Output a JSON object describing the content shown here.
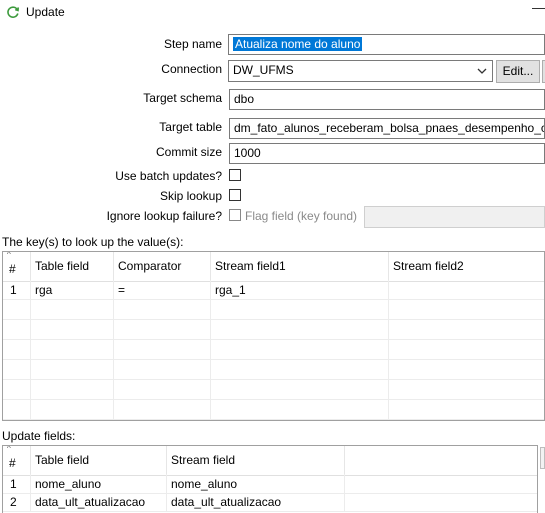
{
  "window": {
    "title": "Update"
  },
  "form": {
    "step_name_label": "Step name",
    "step_name_value": "Atualiza nome do aluno",
    "connection_label": "Connection",
    "connection_value": "DW_UFMS",
    "edit_button": "Edit...",
    "target_schema_label": "Target schema",
    "target_schema_value": "dbo",
    "target_table_label": "Target table",
    "target_table_value": "dm_fato_alunos_receberam_bolsa_pnaes_desempenho_ch",
    "commit_size_label": "Commit size",
    "commit_size_value": "1000",
    "batch_updates_label": "Use batch updates?",
    "skip_lookup_label": "Skip lookup",
    "ignore_failure_label": "Ignore lookup failure?",
    "flag_field_label": "Flag field (key found)"
  },
  "keys_section": {
    "title": "The key(s) to look up the value(s):",
    "columns": [
      "#",
      "Table field",
      "Comparator",
      "Stream field1",
      "Stream field2"
    ],
    "rows": [
      {
        "num": "1",
        "table_field": "rga",
        "comparator": "=",
        "stream1": "rga_1",
        "stream2": ""
      }
    ]
  },
  "update_section": {
    "title": "Update fields:",
    "columns": [
      "#",
      "Table field",
      "Stream field"
    ],
    "rows": [
      {
        "num": "1",
        "table_field": "nome_aluno",
        "stream_field": "nome_aluno"
      },
      {
        "num": "2",
        "table_field": "data_ult_atualizacao",
        "stream_field": "data_ult_atualizacao"
      }
    ]
  },
  "icons": {
    "title_icon": "refresh-icon",
    "combo_arrow": "chevron-down-icon",
    "sort_arrow": "caret-up-icon"
  },
  "colors": {
    "selection": "#0078d7",
    "icon_green": "#3c9a3c"
  }
}
